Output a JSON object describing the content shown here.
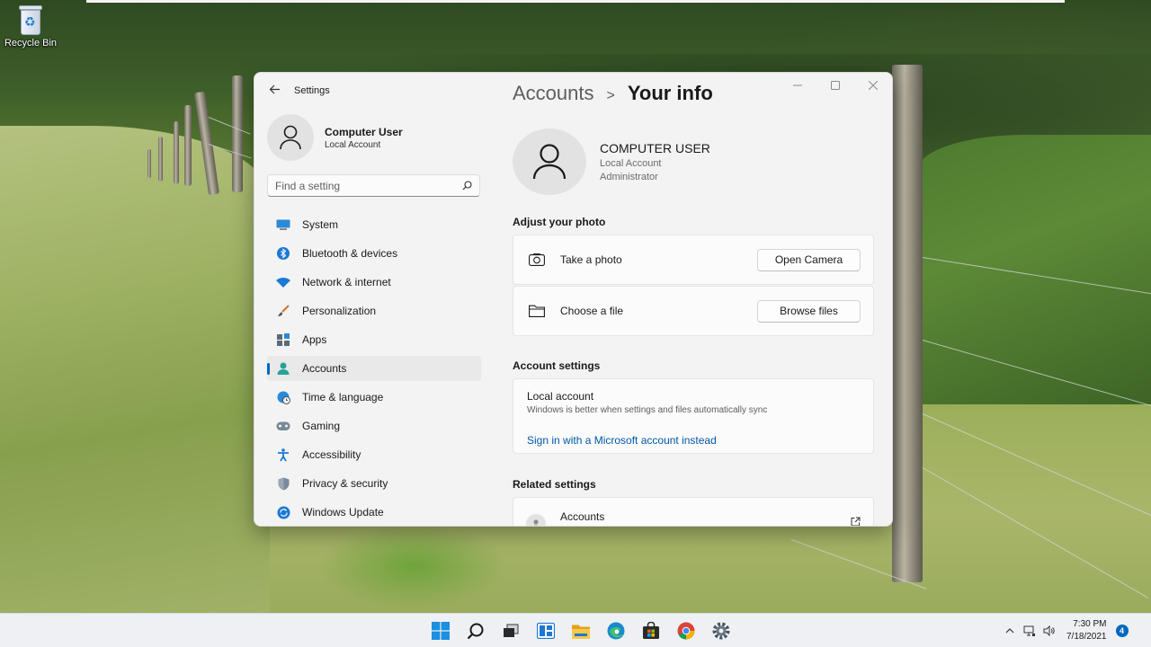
{
  "desktop": {
    "recycle_bin_label": "Recycle Bin"
  },
  "window": {
    "title": "Settings",
    "profile": {
      "name": "Computer User",
      "type": "Local Account"
    },
    "search": {
      "placeholder": "Find a setting"
    },
    "nav": [
      {
        "label": "System",
        "icon": "monitor-icon"
      },
      {
        "label": "Bluetooth & devices",
        "icon": "bluetooth-icon"
      },
      {
        "label": "Network & internet",
        "icon": "wifi-icon"
      },
      {
        "label": "Personalization",
        "icon": "brush-icon"
      },
      {
        "label": "Apps",
        "icon": "apps-icon"
      },
      {
        "label": "Accounts",
        "icon": "person-icon",
        "active": true
      },
      {
        "label": "Time & language",
        "icon": "globe-clock-icon"
      },
      {
        "label": "Gaming",
        "icon": "gamepad-icon"
      },
      {
        "label": "Accessibility",
        "icon": "accessibility-icon"
      },
      {
        "label": "Privacy & security",
        "icon": "shield-icon"
      },
      {
        "label": "Windows Update",
        "icon": "update-icon"
      }
    ]
  },
  "content": {
    "breadcrumb": {
      "parent": "Accounts",
      "separator": ">",
      "current": "Your info"
    },
    "user": {
      "name": "COMPUTER USER",
      "type": "Local Account",
      "role": "Administrator"
    },
    "adjust_photo": {
      "heading": "Adjust your photo",
      "take_photo": {
        "label": "Take a photo",
        "button": "Open Camera"
      },
      "choose_file": {
        "label": "Choose a file",
        "button": "Browse files"
      }
    },
    "account_settings": {
      "heading": "Account settings",
      "title": "Local account",
      "description": "Windows is better when settings and files automatically sync",
      "link": "Sign in with a Microsoft account instead"
    },
    "related_settings": {
      "heading": "Related settings",
      "accounts_label": "Accounts"
    }
  },
  "taskbar": {
    "apps": [
      "start-icon",
      "search-icon",
      "task-view-icon",
      "widgets-icon",
      "file-explorer-icon",
      "edge-icon",
      "store-icon",
      "chrome-icon",
      "settings-icon"
    ],
    "time": "7:30 PM",
    "date": "7/18/2021",
    "notification_count": "4"
  },
  "colors": {
    "accent": "#0067c0",
    "link": "#0058a8",
    "window_bg": "#f3f3f3",
    "card_bg": "#fbfbfb"
  }
}
